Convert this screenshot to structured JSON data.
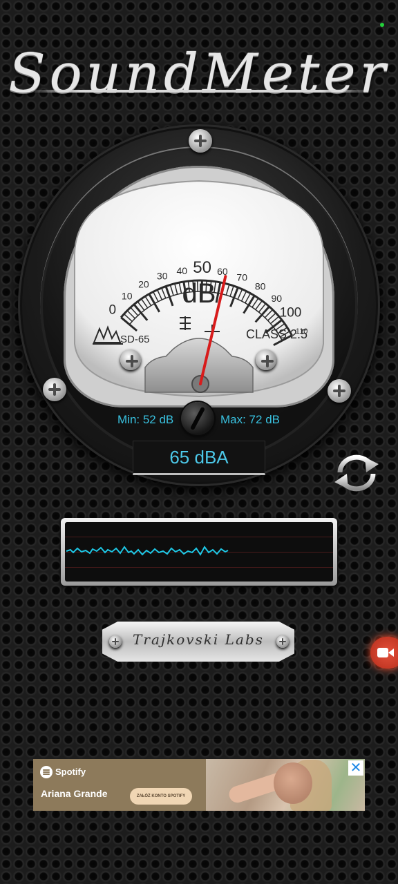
{
  "app": {
    "title": "SoundMeter"
  },
  "gauge": {
    "unit_label": "dB",
    "model": "SD-65",
    "class_label": "CLASS 2.5",
    "needle_value": 62,
    "scale_labels": [
      "0",
      "10",
      "20",
      "30",
      "40",
      "50",
      "60",
      "70",
      "80",
      "90",
      "100",
      "110"
    ],
    "min_label": "Min: 52 dB",
    "max_label": "Max: 72 dB",
    "readout": "65 dBA"
  },
  "plate": {
    "text": "Trajkovski Labs"
  },
  "icons": {
    "reset": "refresh-icon",
    "record": "video-record-icon",
    "close": "close-icon"
  },
  "colors": {
    "accent": "#39c2e0",
    "needle": "#d81b1b",
    "wave": "#1ec8e6",
    "status": "#23d13a"
  },
  "ad": {
    "brand": "Spotify",
    "artist": "Ariana Grande",
    "cta": "ZAŁÓŻ KONTO SPOTIFY",
    "close": "✕"
  }
}
